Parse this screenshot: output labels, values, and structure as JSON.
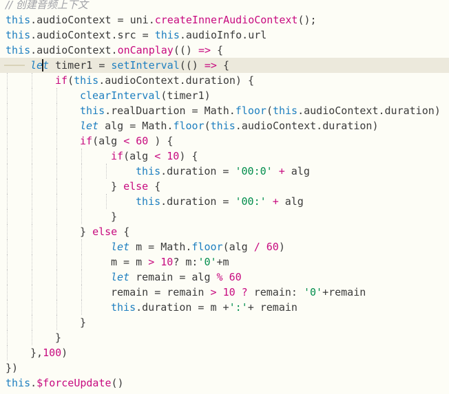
{
  "editor": {
    "lines": [
      {
        "indent": 0,
        "tokens": [
          {
            "t": "// 创建音频上下文",
            "c": "cm"
          }
        ]
      },
      {
        "indent": 0,
        "tokens": [
          {
            "t": "this",
            "c": "th"
          },
          {
            "t": ".audioContext = uni.",
            "c": "op"
          },
          {
            "t": "createInnerAudioContext",
            "c": "fn"
          },
          {
            "t": "();",
            "c": "op"
          }
        ]
      },
      {
        "indent": 0,
        "tokens": [
          {
            "t": "this",
            "c": "th"
          },
          {
            "t": ".audioContext.src = ",
            "c": "op"
          },
          {
            "t": "this",
            "c": "th"
          },
          {
            "t": ".audioInfo.url",
            "c": "op"
          }
        ]
      },
      {
        "indent": 0,
        "tokens": [
          {
            "t": "this",
            "c": "th"
          },
          {
            "t": ".audioContext.",
            "c": "op"
          },
          {
            "t": "onCanplay",
            "c": "fn"
          },
          {
            "t": "(() ",
            "c": "op"
          },
          {
            "t": "=>",
            "c": "kw"
          },
          {
            "t": " {",
            "c": "op"
          }
        ]
      },
      {
        "indent": 1,
        "current": true,
        "tokens": [
          {
            "t": "let",
            "c": "it"
          },
          {
            "t": " timer1 = ",
            "c": "op"
          },
          {
            "t": "setInterval",
            "c": "th"
          },
          {
            "t": "(() ",
            "c": "op"
          },
          {
            "t": "=>",
            "c": "kw"
          },
          {
            "t": " {",
            "c": "op"
          }
        ]
      },
      {
        "indent": 2,
        "tokens": [
          {
            "t": "if",
            "c": "kw"
          },
          {
            "t": "(",
            "c": "op"
          },
          {
            "t": "this",
            "c": "th"
          },
          {
            "t": ".audioContext.duration) {",
            "c": "op"
          }
        ]
      },
      {
        "indent": 3,
        "tokens": [
          {
            "t": "clearInterval",
            "c": "th"
          },
          {
            "t": "(timer1)",
            "c": "op"
          }
        ]
      },
      {
        "indent": 3,
        "tokens": [
          {
            "t": "this",
            "c": "th"
          },
          {
            "t": ".realDuartion = Math.",
            "c": "op"
          },
          {
            "t": "floor",
            "c": "th"
          },
          {
            "t": "(",
            "c": "op"
          },
          {
            "t": "this",
            "c": "th"
          },
          {
            "t": ".audioContext.duration)",
            "c": "op"
          }
        ]
      },
      {
        "indent": 3,
        "tokens": [
          {
            "t": "let",
            "c": "it"
          },
          {
            "t": " alg = Math.",
            "c": "op"
          },
          {
            "t": "floor",
            "c": "th"
          },
          {
            "t": "(",
            "c": "op"
          },
          {
            "t": "this",
            "c": "th"
          },
          {
            "t": ".audioContext.duration)",
            "c": "op"
          }
        ]
      },
      {
        "indent": 3,
        "tokens": [
          {
            "t": "if",
            "c": "kw"
          },
          {
            "t": "(alg ",
            "c": "op"
          },
          {
            "t": "<",
            "c": "kw"
          },
          {
            "t": " ",
            "c": "op"
          },
          {
            "t": "60",
            "c": "num"
          },
          {
            "t": " ) {",
            "c": "op"
          }
        ]
      },
      {
        "indent": 4,
        "tokens": [
          {
            "t": "if",
            "c": "kw"
          },
          {
            "t": "(alg ",
            "c": "op"
          },
          {
            "t": "<",
            "c": "kw"
          },
          {
            "t": " ",
            "c": "op"
          },
          {
            "t": "10",
            "c": "num"
          },
          {
            "t": ") {",
            "c": "op"
          }
        ]
      },
      {
        "indent": 5,
        "tokens": [
          {
            "t": "this",
            "c": "th"
          },
          {
            "t": ".duration = ",
            "c": "op"
          },
          {
            "t": "'00:0'",
            "c": "str"
          },
          {
            "t": " ",
            "c": "op"
          },
          {
            "t": "+",
            "c": "kw"
          },
          {
            "t": " alg",
            "c": "op"
          }
        ]
      },
      {
        "indent": 4,
        "tokens": [
          {
            "t": "} ",
            "c": "op"
          },
          {
            "t": "else",
            "c": "kw"
          },
          {
            "t": " {",
            "c": "op"
          }
        ]
      },
      {
        "indent": 5,
        "tokens": [
          {
            "t": "this",
            "c": "th"
          },
          {
            "t": ".duration = ",
            "c": "op"
          },
          {
            "t": "'00:'",
            "c": "str"
          },
          {
            "t": " ",
            "c": "op"
          },
          {
            "t": "+",
            "c": "kw"
          },
          {
            "t": " alg",
            "c": "op"
          }
        ]
      },
      {
        "indent": 4,
        "tokens": [
          {
            "t": "}",
            "c": "op"
          }
        ]
      },
      {
        "indent": 3,
        "tokens": [
          {
            "t": "} ",
            "c": "op"
          },
          {
            "t": "else",
            "c": "kw"
          },
          {
            "t": " {",
            "c": "op"
          }
        ]
      },
      {
        "indent": 4,
        "tokens": [
          {
            "t": "let",
            "c": "it"
          },
          {
            "t": " m = Math.",
            "c": "op"
          },
          {
            "t": "floor",
            "c": "th"
          },
          {
            "t": "(alg ",
            "c": "op"
          },
          {
            "t": "/",
            "c": "kw"
          },
          {
            "t": " ",
            "c": "op"
          },
          {
            "t": "60",
            "c": "num"
          },
          {
            "t": ")",
            "c": "op"
          }
        ]
      },
      {
        "indent": 4,
        "tokens": [
          {
            "t": "m = m ",
            "c": "op"
          },
          {
            "t": ">",
            "c": "kw"
          },
          {
            "t": " ",
            "c": "op"
          },
          {
            "t": "10",
            "c": "num"
          },
          {
            "t": "? m:",
            "c": "op"
          },
          {
            "t": "'0'",
            "c": "str"
          },
          {
            "t": "+m",
            "c": "op"
          }
        ]
      },
      {
        "indent": 4,
        "tokens": [
          {
            "t": "let",
            "c": "it"
          },
          {
            "t": " remain = alg ",
            "c": "op"
          },
          {
            "t": "%",
            "c": "kw"
          },
          {
            "t": " ",
            "c": "op"
          },
          {
            "t": "60",
            "c": "num"
          }
        ]
      },
      {
        "indent": 4,
        "tokens": [
          {
            "t": "remain = remain ",
            "c": "op"
          },
          {
            "t": ">",
            "c": "kw"
          },
          {
            "t": " ",
            "c": "op"
          },
          {
            "t": "10",
            "c": "num"
          },
          {
            "t": " ",
            "c": "op"
          },
          {
            "t": "?",
            "c": "kw"
          },
          {
            "t": " remain: ",
            "c": "op"
          },
          {
            "t": "'0'",
            "c": "str"
          },
          {
            "t": "+remain",
            "c": "op"
          }
        ]
      },
      {
        "indent": 4,
        "tokens": [
          {
            "t": "this",
            "c": "th"
          },
          {
            "t": ".duration = m +",
            "c": "op"
          },
          {
            "t": "':'",
            "c": "str"
          },
          {
            "t": "+ remain",
            "c": "op"
          }
        ]
      },
      {
        "indent": 3,
        "tokens": [
          {
            "t": "}",
            "c": "op"
          }
        ]
      },
      {
        "indent": 2,
        "tokens": [
          {
            "t": "}",
            "c": "op"
          }
        ]
      },
      {
        "indent": 1,
        "tokens": [
          {
            "t": "},",
            "c": "op"
          },
          {
            "t": "100",
            "c": "num"
          },
          {
            "t": ")",
            "c": "op"
          }
        ]
      },
      {
        "indent": 0,
        "tokens": [
          {
            "t": "})",
            "c": "op"
          }
        ]
      },
      {
        "indent": 0,
        "tokens": [
          {
            "t": "this",
            "c": "th"
          },
          {
            "t": ".",
            "c": "op"
          },
          {
            "t": "$forceUpdate",
            "c": "fn"
          },
          {
            "t": "()",
            "c": "op"
          }
        ]
      }
    ],
    "colors": {
      "background": "#fdfdf6",
      "current_line": "#ece9dc",
      "this": "#1e7fc0",
      "keyword": "#c70a7f",
      "string": "#008d4c",
      "comment": "#a0a1a7",
      "plain": "#3a3a3a"
    }
  }
}
